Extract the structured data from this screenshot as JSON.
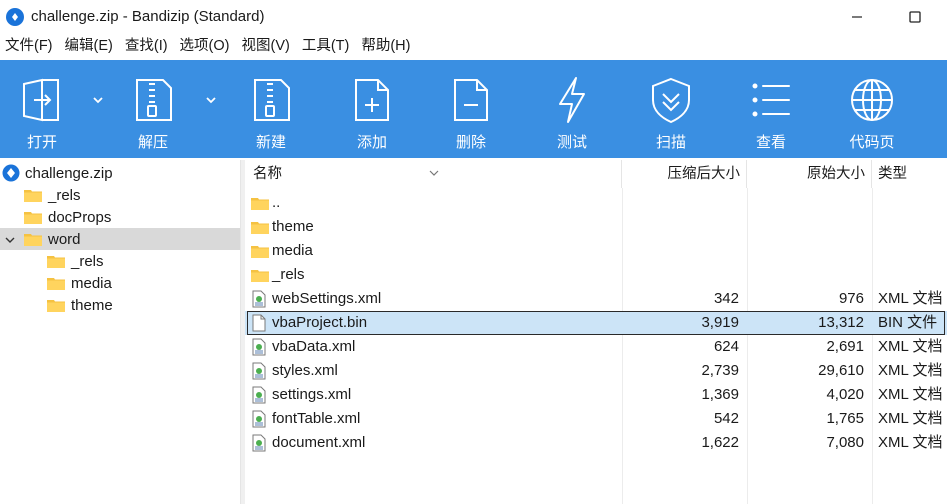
{
  "window": {
    "title": "challenge.zip - Bandizip (Standard)"
  },
  "menu": [
    "文件(F)",
    "编辑(E)",
    "查找(I)",
    "选项(O)",
    "视图(V)",
    "工具(T)",
    "帮助(H)"
  ],
  "toolbar": {
    "open": "打开",
    "extract": "解压",
    "new": "新建",
    "add": "添加",
    "delete": "删除",
    "test": "测试",
    "scan": "扫描",
    "view": "查看",
    "codepage": "代码页"
  },
  "tree": {
    "root": "challenge.zip",
    "items": [
      {
        "label": "_rels"
      },
      {
        "label": "docProps"
      },
      {
        "label": "word"
      },
      {
        "label": "_rels"
      },
      {
        "label": "media"
      },
      {
        "label": "theme"
      }
    ]
  },
  "list": {
    "columns": {
      "name": "名称",
      "compressed": "压缩后大小",
      "original": "原始大小",
      "type": "类型"
    },
    "rows": [
      {
        "name": "..",
        "compressed": "",
        "original": "",
        "type": ""
      },
      {
        "name": "theme",
        "compressed": "",
        "original": "",
        "type": ""
      },
      {
        "name": "media",
        "compressed": "",
        "original": "",
        "type": ""
      },
      {
        "name": "_rels",
        "compressed": "",
        "original": "",
        "type": ""
      },
      {
        "name": "webSettings.xml",
        "compressed": "342",
        "original": "976",
        "type": "XML 文档"
      },
      {
        "name": "vbaProject.bin",
        "compressed": "3,919",
        "original": "13,312",
        "type": "BIN 文件"
      },
      {
        "name": "vbaData.xml",
        "compressed": "624",
        "original": "2,691",
        "type": "XML 文档"
      },
      {
        "name": "styles.xml",
        "compressed": "2,739",
        "original": "29,610",
        "type": "XML 文档"
      },
      {
        "name": "settings.xml",
        "compressed": "1,369",
        "original": "4,020",
        "type": "XML 文档"
      },
      {
        "name": "fontTable.xml",
        "compressed": "542",
        "original": "1,765",
        "type": "XML 文档"
      },
      {
        "name": "document.xml",
        "compressed": "1,622",
        "original": "7,080",
        "type": "XML 文档"
      }
    ]
  },
  "colors": {
    "toolbar": "#3a8fe2",
    "selected_row": "#cce4f7",
    "tree_selected": "#d9d9d9",
    "folder": "#f5c242"
  }
}
